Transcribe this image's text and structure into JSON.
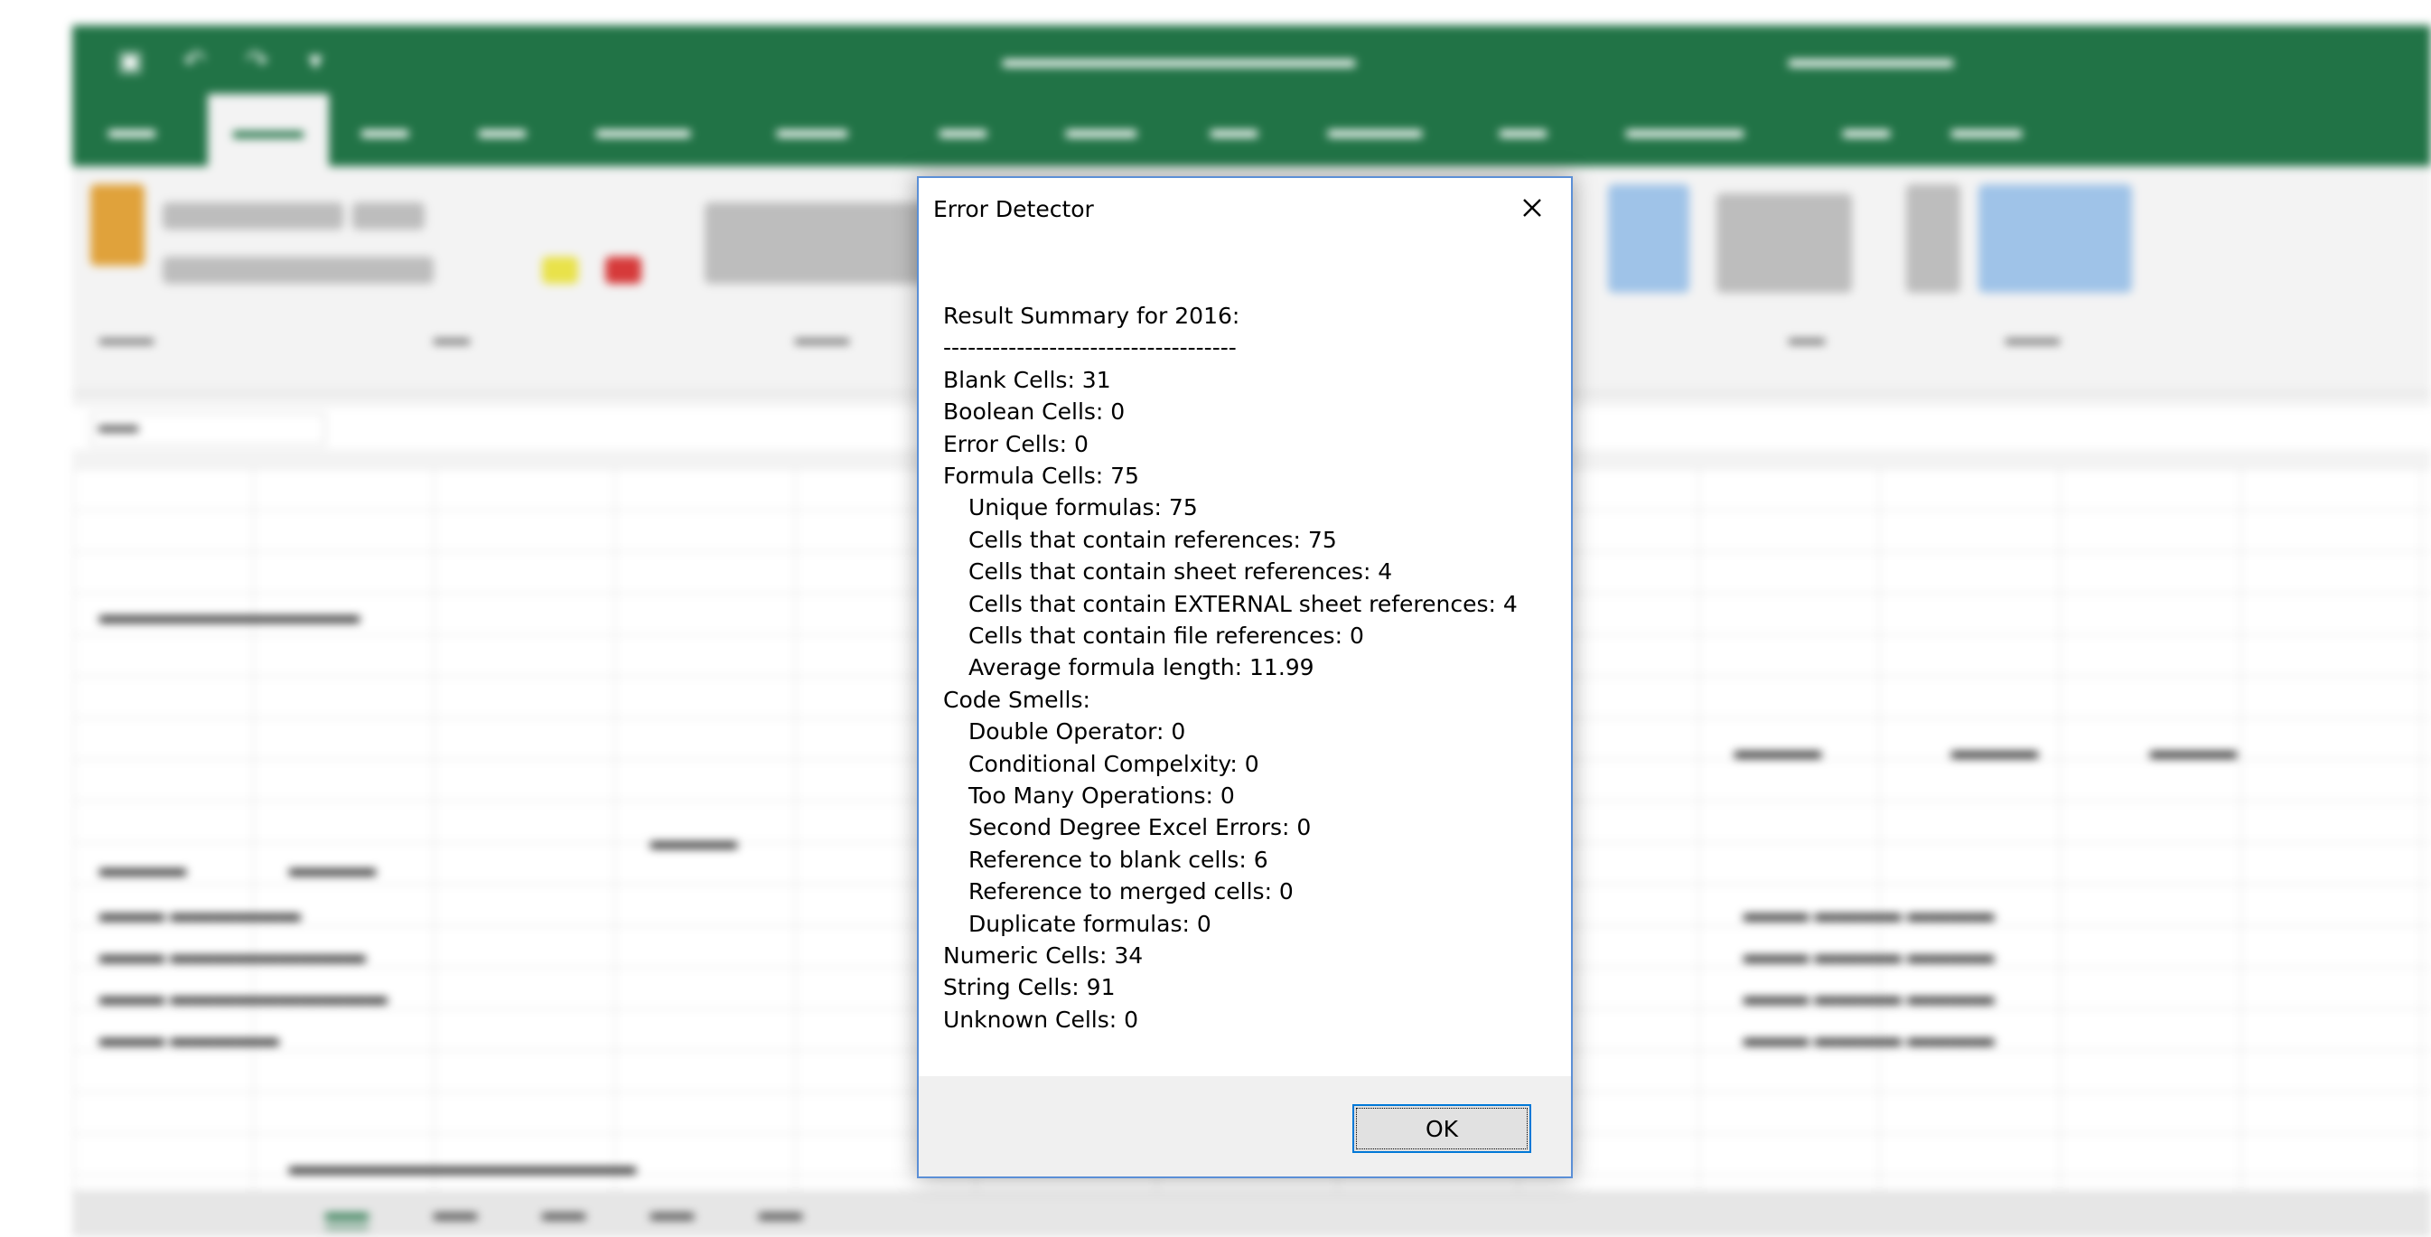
{
  "dialog": {
    "title": "Error Detector",
    "ok_label": "OK",
    "lines": [
      {
        "text": "Result Summary for 2016:",
        "indent": false
      },
      {
        "text": "------------------------------------",
        "indent": false
      },
      {
        "text": "Blank Cells: 31",
        "indent": false
      },
      {
        "text": "Boolean Cells: 0",
        "indent": false
      },
      {
        "text": "Error Cells: 0",
        "indent": false
      },
      {
        "text": "Formula Cells: 75",
        "indent": false
      },
      {
        "text": "Unique formulas: 75",
        "indent": true
      },
      {
        "text": "Cells that contain references: 75",
        "indent": true
      },
      {
        "text": "Cells that contain sheet references: 4",
        "indent": true
      },
      {
        "text": "Cells that contain EXTERNAL sheet references: 4",
        "indent": true
      },
      {
        "text": "Cells that contain file references: 0",
        "indent": true
      },
      {
        "text": "Average formula length: 11.99",
        "indent": true
      },
      {
        "text": "Code Smells:",
        "indent": false
      },
      {
        "text": "Double Operator: 0",
        "indent": true
      },
      {
        "text": "Conditional Compelxity: 0",
        "indent": true
      },
      {
        "text": "Too Many Operations: 0",
        "indent": true
      },
      {
        "text": "Second Degree Excel Errors: 0",
        "indent": true
      },
      {
        "text": "Reference to blank cells: 6",
        "indent": true
      },
      {
        "text": "Reference to merged cells: 0",
        "indent": true
      },
      {
        "text": "Duplicate formulas: 0",
        "indent": true
      },
      {
        "text": "Numeric Cells: 34",
        "indent": false
      },
      {
        "text": "String Cells: 91",
        "indent": false
      },
      {
        "text": "Unknown Cells: 0",
        "indent": false
      }
    ]
  },
  "colors": {
    "excel_green": "#217346",
    "dialog_border": "#5b8fd6",
    "ok_border": "#0078d7"
  }
}
